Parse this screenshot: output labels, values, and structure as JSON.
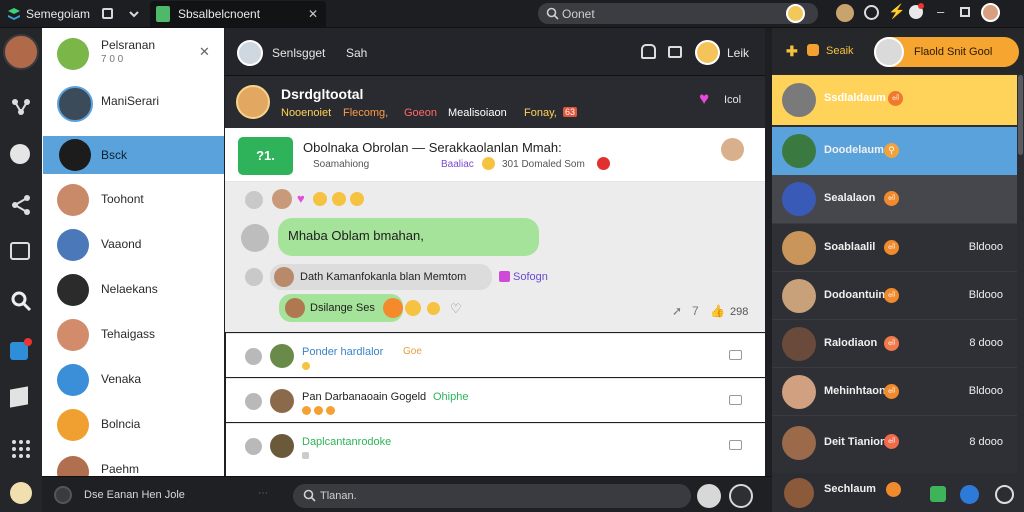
{
  "titlebar": {
    "app_name": "Semegoiam",
    "tab_title": "Sbsalbelcnoent",
    "search_placeholder": "Oonet"
  },
  "contacts": [
    {
      "name": "Pelsranan",
      "sub": "7 0 0"
    },
    {
      "name": "ManiSerari"
    },
    {
      "name": "Bsck"
    },
    {
      "name": "Toohont"
    },
    {
      "name": "Vaaond"
    },
    {
      "name": "Nelaekans"
    },
    {
      "name": "Tehaigass"
    },
    {
      "name": "Venaka"
    },
    {
      "name": "Bolncia"
    },
    {
      "name": "Paehm"
    }
  ],
  "chat_header": {
    "name": "Senlsgget",
    "role": "Sah",
    "action_label": "Leik"
  },
  "banner": {
    "title": "Dsrdgltootal",
    "tags": [
      "Nooenoiet",
      "Flecomg,",
      "Goeon",
      "Mealisoiaon",
      "Fonay,",
      "63"
    ],
    "right_label": "Icol"
  },
  "pinned": {
    "badge": "?1.",
    "title": "Obolnaka Obrolan — Serakkaolanlan Mmah:",
    "meta": "Soamahiong Baaliac 301 Domaled Som",
    "meta_part1": "Soamahiong",
    "meta_part2": "Baaliac",
    "meta_part3": "301 Domaled Som"
  },
  "messages": [
    {
      "text": "Mhaba Oblam bmahan,"
    },
    {
      "text": "Dath Kamanfokanla blan Memtom",
      "tag": "Sofogn"
    },
    {
      "text": "Dsilange Ses",
      "count": "298"
    }
  ],
  "threads": [
    {
      "title": "Ponder hardlalor",
      "tag": "Goe"
    },
    {
      "title": "Pan Darbanaoain Gogeld",
      "tag": "Ohiphe"
    },
    {
      "title": "Daplcantanrodoke"
    }
  ],
  "right_panel": {
    "header": {
      "label": "Seaik",
      "button": "Flaold Snit Gool"
    },
    "rows": [
      {
        "name": "Ssdlaldaum"
      },
      {
        "name": "Doodelaum"
      },
      {
        "name": "Sealalaon"
      },
      {
        "name": "Soablaalil",
        "count": "Bldooo"
      },
      {
        "name": "Dodoantuin",
        "count": "Bldooo"
      },
      {
        "name": "Ralodiaon",
        "count": "8 dooo"
      },
      {
        "name": "Mehinhtaon",
        "count": "Bldooo"
      },
      {
        "name": "Deit Tianion",
        "count": "8 dooo"
      },
      {
        "name": "Sechlaum"
      }
    ]
  },
  "bottom": {
    "status": "Dse Eanan Hen Jole",
    "composer_placeholder": "Tlanan."
  },
  "colors": {
    "accent_blue": "#5aa2dc",
    "accent_green": "#2fb35a",
    "accent_yellow": "#ffd35a",
    "badge_orange": "#f08a2c"
  }
}
